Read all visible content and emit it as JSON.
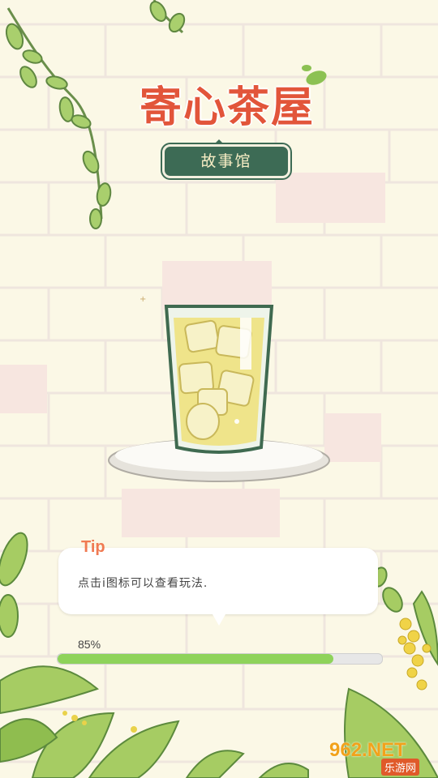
{
  "logo": {
    "title": "寄心茶屋",
    "subtitle": "故事馆"
  },
  "tip": {
    "title": "Tip",
    "text": "点击i图标可以查看玩法."
  },
  "loading": {
    "percent_label": "85%",
    "progress": 0.85
  },
  "watermark": {
    "main": "962.NET",
    "sub": "乐游网"
  },
  "colors": {
    "title": "#e2553a",
    "plaque": "#3d6b55",
    "tip_title": "#f07a52",
    "progress": "#8ed35a"
  },
  "icons": [
    "vine-leaves-icon",
    "tea-glass-icon",
    "leaf-decoration-icon"
  ]
}
